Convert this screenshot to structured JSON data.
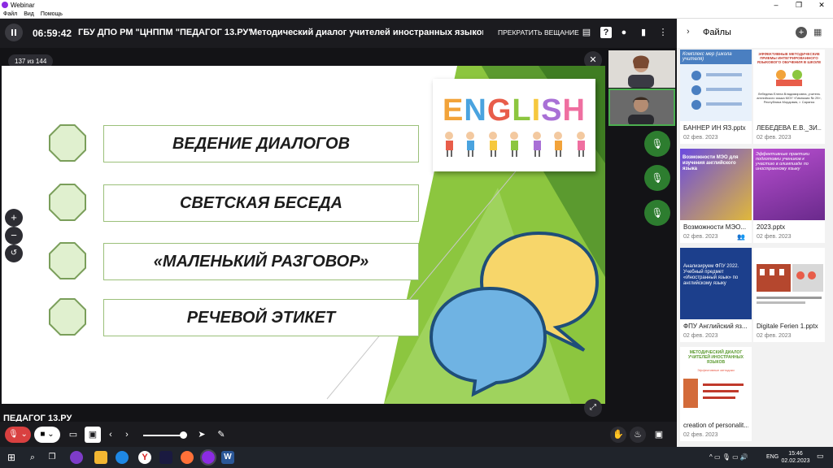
{
  "window": {
    "title": "Webinar"
  },
  "menu": [
    "Файл",
    "Вид",
    "Помощь"
  ],
  "header": {
    "timer": "06:59:42",
    "org": "ГБУ ДПО РМ \"ЦНППМ \"ПЕДАГОГ 13.РУ\"",
    "event_title": "Методический диалог учителей иностранных языков П",
    "stop_label": "ПРЕКРАТИТЬ ВЕЩАНИЕ",
    "icons": [
      "chat-icon",
      "question-icon",
      "user-icon",
      "file-icon",
      "more-icon"
    ]
  },
  "slide": {
    "counter": "137 из 144",
    "topics": [
      "ВЕДЕНИЕ ДИАЛОГОВ",
      "СВЕТСКАЯ БЕСЕДА",
      "«МАЛЕНЬКИЙ РАЗГОВОР»",
      "РЕЧЕВОЙ ЭТИКЕТ"
    ],
    "english_word": [
      "E",
      "N",
      "G",
      "L",
      "I",
      "S",
      "H"
    ],
    "english_colors": [
      "#f2a33a",
      "#4aa3df",
      "#e85d4a",
      "#8cc63f",
      "#f6c83e",
      "#a970d6",
      "#ef6fa0"
    ],
    "accent_green": "#8cc63f",
    "bubble_yellow": "#f7d66a",
    "bubble_blue": "#6fb3e3",
    "bubble_outline": "#1f4e79"
  },
  "side_tools": [
    "zoom-in-icon",
    "zoom-out-icon",
    "reset-icon"
  ],
  "watermark": "ПЕДАГОГ 13.РУ",
  "files": {
    "title": "Файлы",
    "items": [
      {
        "name": "БАННЕР ИН ЯЗ.pptx",
        "date": "02 фев. 2023",
        "thumb_text": "Комплекс мер (школа учителя)"
      },
      {
        "name": "ЛЕБЕДЕВА Е.В._ЗИ...",
        "date": "02 фев. 2023",
        "thumb_text": "ЭФФЕКТИВНЫЕ МЕТОДИЧЕСКИЕ ПРИЕМЫ ИНТЕГРИРОВАННОГО ЯЗЫКОВОГО ОБУЧЕНИЯ В ШКОЛЕ",
        "thumb_sub": "Лебедева Елена Владимировна, учитель английского языка МОУ «Гимназия № 29», Республика Мордовия, г. Саранск"
      },
      {
        "name": "Возможности МЭО...",
        "date": "02 фев. 2023",
        "thumb_text": "Возможности МЭО для изучения английского языка"
      },
      {
        "name": "2023.pptx",
        "date": "02 фев. 2023",
        "thumb_text": "Эффективные практики подготовки учеников к участию в олимпиаде по иностранному языку"
      },
      {
        "name": "ФПУ Английский яз...",
        "date": "02 фев. 2023",
        "thumb_text": "Анализируем ФПУ 2022. Учебный предмет «Иностранный язык» по английскому языку"
      },
      {
        "name": "Digitale Ferien 1.pptx",
        "date": "02 фев. 2023",
        "thumb_text": ""
      },
      {
        "name": "creation of personalit...",
        "date": "02 фев. 2023",
        "thumb_text": "МЕТОДИЧЕСКИЙ ДИАЛОГ УЧИТЕЛЕЙ ИНОСТРАННЫХ ЯЗЫКОВ",
        "thumb_sub": "Эффективные методики"
      }
    ]
  },
  "taskbar": {
    "time": "15:46",
    "date": "02.02.2023",
    "lang": "ENG"
  }
}
